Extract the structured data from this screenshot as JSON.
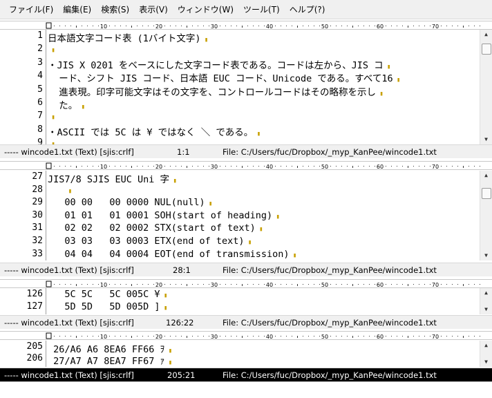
{
  "menu": [
    {
      "label": "ファイル(F)"
    },
    {
      "label": "編集(E)"
    },
    {
      "label": "検索(S)"
    },
    {
      "label": "表示(V)"
    },
    {
      "label": "ウィンドウ(W)"
    },
    {
      "label": "ツール(T)"
    },
    {
      "label": "ヘルプ(?)"
    }
  ],
  "ruler_labels": [
    "10",
    "20",
    "30",
    "40",
    "50",
    "60",
    "70"
  ],
  "panes": [
    {
      "lines": [
        {
          "num": "1",
          "text": "日本語文字コード表 (1バイト文字)"
        },
        {
          "num": "2",
          "text": ""
        },
        {
          "num": "3",
          "text": "・JIS X 0201 をベースにした文字コード表である。コードは左から、JIS コ"
        },
        {
          "num": "4",
          "text": "  ード、シフト JIS コード、日本語 EUC コード、Unicode である。すべて16"
        },
        {
          "num": "5",
          "text": "  進表現。印字可能文字はその文字を、コントロールコードはその略称を示し"
        },
        {
          "num": "6",
          "text": "  た。"
        },
        {
          "num": "7",
          "text": ""
        },
        {
          "num": "8",
          "text": "・ASCII では 5C は ¥ ではなく ＼ である。"
        },
        {
          "num": "9",
          "text": ""
        }
      ],
      "status": {
        "file": "----- wincode1.txt (Text) [sjis:crlf]",
        "pos": "1:1",
        "path": "File: C:/Users/fuc/Dropbox/_myp_KanPee/wincode1.txt"
      }
    },
    {
      "lines": [
        {
          "num": "27",
          "text": "JIS7/8 SJIS EUC Uni 字"
        },
        {
          "num": "28",
          "text": "   "
        },
        {
          "num": "29",
          "text": "   00 00   00 0000 NUL(null)"
        },
        {
          "num": "30",
          "text": "   01 01   01 0001 SOH(start of heading)"
        },
        {
          "num": "31",
          "text": "   02 02   02 0002 STX(start of text)"
        },
        {
          "num": "32",
          "text": "   03 03   03 0003 ETX(end of text)"
        },
        {
          "num": "33",
          "text": "   04 04   04 0004 EOT(end of transmission)"
        }
      ],
      "status": {
        "file": "----- wincode1.txt (Text) [sjis:crlf]",
        "pos": "28:1",
        "path": "File: C:/Users/fuc/Dropbox/_myp_KanPee/wincode1.txt"
      }
    },
    {
      "lines": [
        {
          "num": "126",
          "text": "   5C 5C   5C 005C ¥"
        },
        {
          "num": "127",
          "text": "   5D 5D   5D 005D ]"
        }
      ],
      "status": {
        "file": "----- wincode1.txt (Text) [sjis:crlf]",
        "pos": "126:22",
        "path": "File: C:/Users/fuc/Dropbox/_myp_KanPee/wincode1.txt"
      }
    },
    {
      "lines": [
        {
          "num": "205",
          "text": " 26/A6 A6 8EA6 FF66 ｦ"
        },
        {
          "num": "206",
          "text": " 27/A7 A7 8EA7 FF67 ｧ"
        }
      ],
      "status": {
        "file": "----- wincode1.txt (Text) [sjis:crlf]",
        "pos": "205:21",
        "path": "File: C:/Users/fuc/Dropbox/_myp_KanPee/wincode1.txt"
      }
    }
  ]
}
